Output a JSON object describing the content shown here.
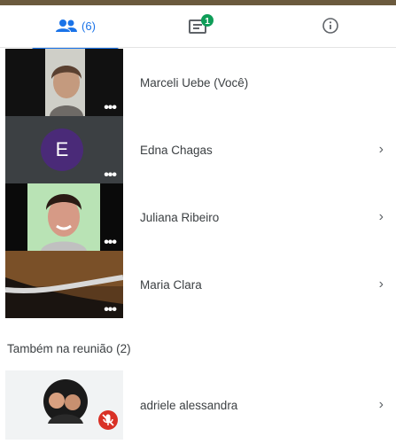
{
  "tabs": {
    "people_count": "(6)",
    "chat_badge": "1"
  },
  "participants": [
    {
      "name": "Marceli Uebe (Você)"
    },
    {
      "name": "Edna Chagas",
      "initial": "E"
    },
    {
      "name": "Juliana Ribeiro"
    },
    {
      "name": "Maria Clara"
    }
  ],
  "also_in_meeting": {
    "title": "Também na reunião (2)",
    "people": [
      {
        "name": "adriele alessandra"
      }
    ]
  },
  "colors": {
    "accent": "#1a73e8",
    "badge": "#0f9d58",
    "mute": "#d93025",
    "avatar_purple": "#4a2a78"
  }
}
